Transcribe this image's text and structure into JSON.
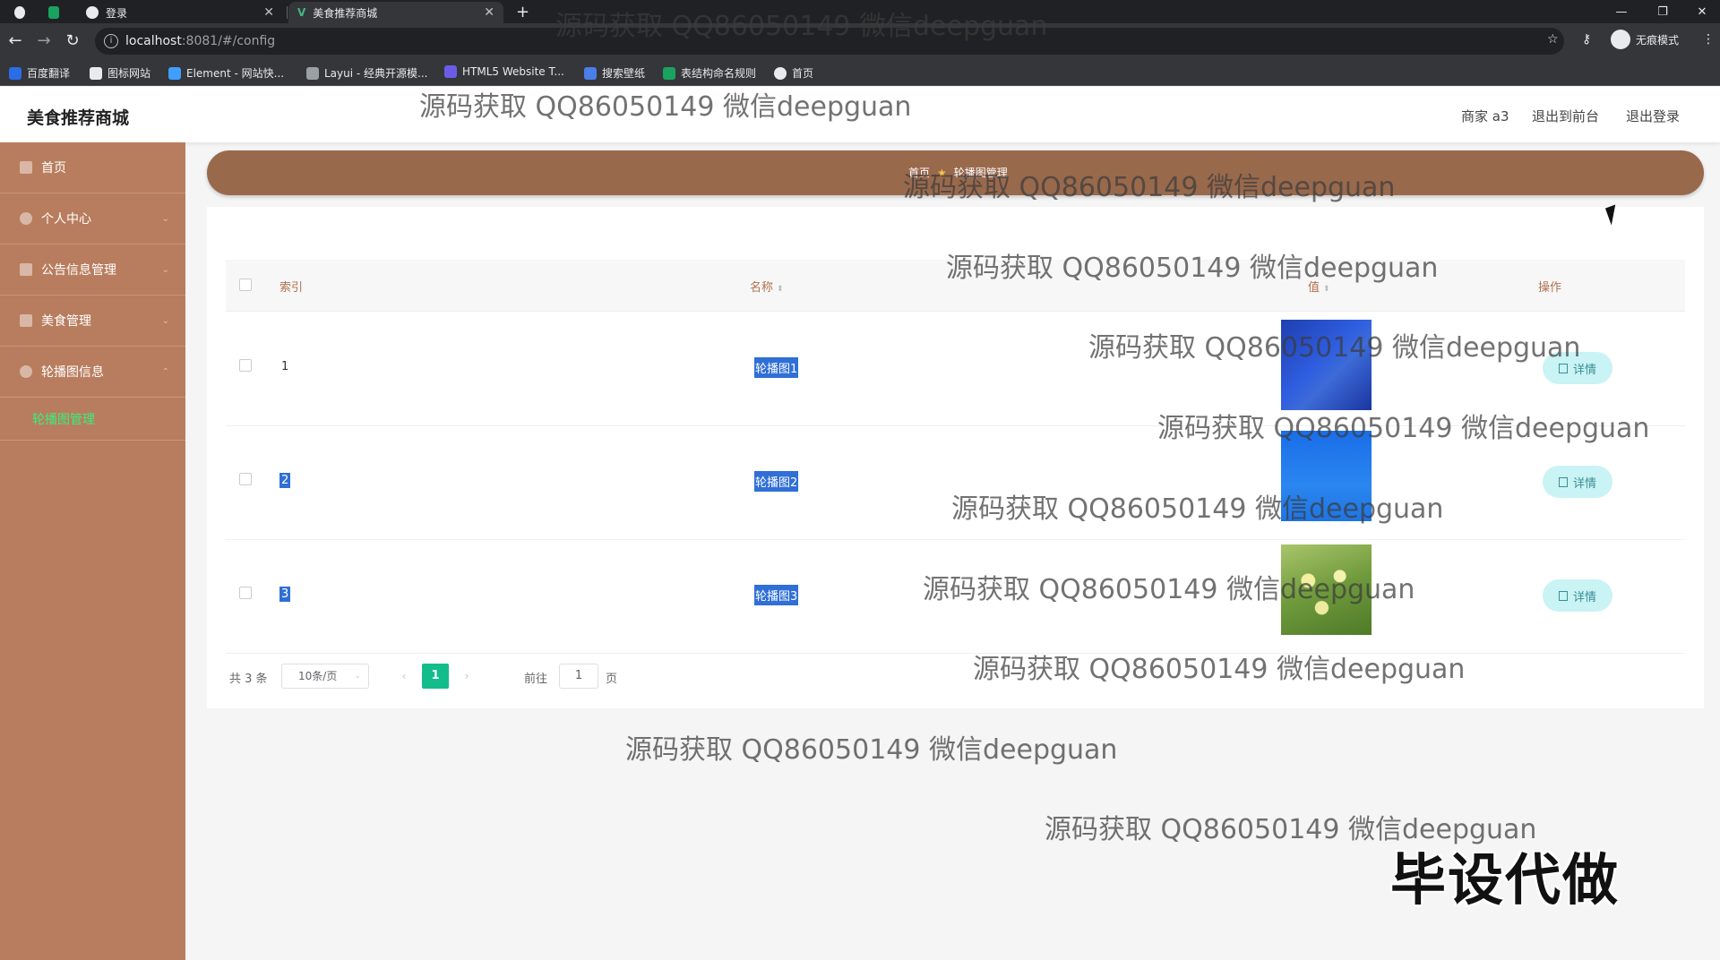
{
  "browser": {
    "tabs": [
      {
        "label": "",
        "icon": "chrome-icon"
      },
      {
        "label": "",
        "icon": "green-app-icon"
      },
      {
        "label": "登录",
        "icon": "globe-icon"
      },
      {
        "label": "美食推荐商城",
        "icon": "vue-icon"
      }
    ],
    "url_host": "localhost",
    "url_path": ":8081/#/config",
    "incognito_label": "无痕模式",
    "bookmarks": [
      "百度翻译",
      "图标网站",
      "Element - 网站快...",
      "Layui - 经典开源模...",
      "HTML5 Website T...",
      "搜索壁纸",
      "表结构命名规则",
      "首页"
    ]
  },
  "header": {
    "brand": "美食推荐商城",
    "links": [
      "商家 a3",
      "退出到前台",
      "退出登录"
    ]
  },
  "sidebar": {
    "items": [
      {
        "label": "首页"
      },
      {
        "label": "个人中心"
      },
      {
        "label": "公告信息管理"
      },
      {
        "label": "美食管理"
      },
      {
        "label": "轮播图信息"
      }
    ],
    "subitem": "轮播图管理"
  },
  "banner": {
    "crumb_left": "首页",
    "crumb_right": "轮播图管理"
  },
  "table": {
    "headers": {
      "index": "索引",
      "name": "名称",
      "value": "值",
      "action": "操作"
    },
    "rows": [
      {
        "index": "1",
        "name": "轮播图1",
        "action": "详情"
      },
      {
        "index": "2",
        "name": "轮播图2",
        "action": "详情"
      },
      {
        "index": "3",
        "name": "轮播图3",
        "action": "详情"
      }
    ]
  },
  "pagination": {
    "total": "共 3 条",
    "page_size": "10条/页",
    "current": "1",
    "goto_label": "前往",
    "goto_value": "1",
    "goto_unit": "页"
  },
  "watermark": {
    "text": "源码获取 QQ86050149 微信deepguan",
    "big": "毕设代做"
  },
  "colors": {
    "sidebar": "#b87d5e",
    "banner": "#99694c",
    "accent_green": "#12bd8b",
    "selection_blue": "#2f6fd6"
  }
}
